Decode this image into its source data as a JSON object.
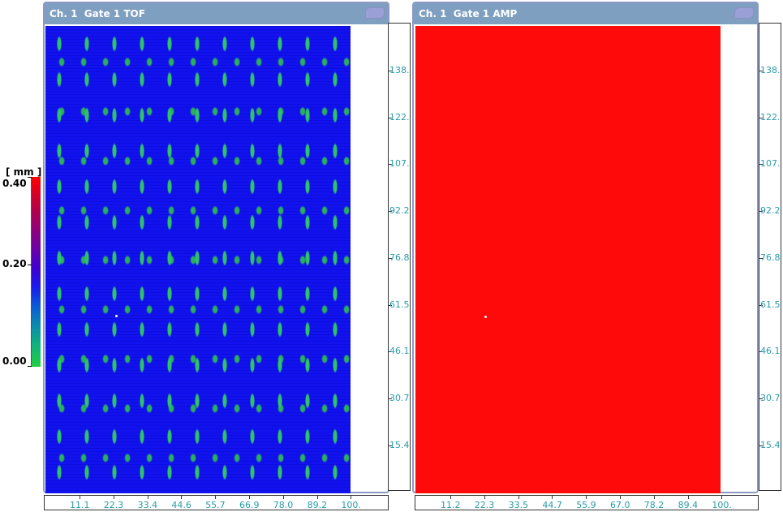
{
  "windows": [
    {
      "title": "Ch. 1  Gate 1 TOF",
      "type": "tof",
      "y_ticks": [
        "138.",
        "122.",
        "107.",
        "92.2",
        "76.8",
        "61.5",
        "46.1",
        "30.7",
        "15.4"
      ],
      "x_ticks": [
        "11.1",
        "22.3",
        "33.4",
        "44.6",
        "55.7",
        "66.9",
        "78.0",
        "89.2",
        "100."
      ]
    },
    {
      "title": "Ch. 1  Gate 1 AMP",
      "type": "amp",
      "y_ticks": [
        "138.",
        "122.",
        "107.",
        "92.2",
        "76.8",
        "61.5",
        "46.1",
        "30.7",
        "15.4"
      ],
      "x_ticks": [
        "11.2",
        "22.3",
        "33.5",
        "44.7",
        "55.9",
        "67.0",
        "78.2",
        "89.4",
        "100."
      ]
    }
  ],
  "legend": {
    "unit": "[ mm ]",
    "max": "0.40",
    "mid": "0.20",
    "min": "0.00"
  },
  "colors": {
    "tof_background": "#1212ee",
    "tof_spots": "#2ec26a",
    "amp_background": "#ff0a0a",
    "titlebar": "#7f9fc0",
    "axis_text": "#2a9aa8"
  }
}
